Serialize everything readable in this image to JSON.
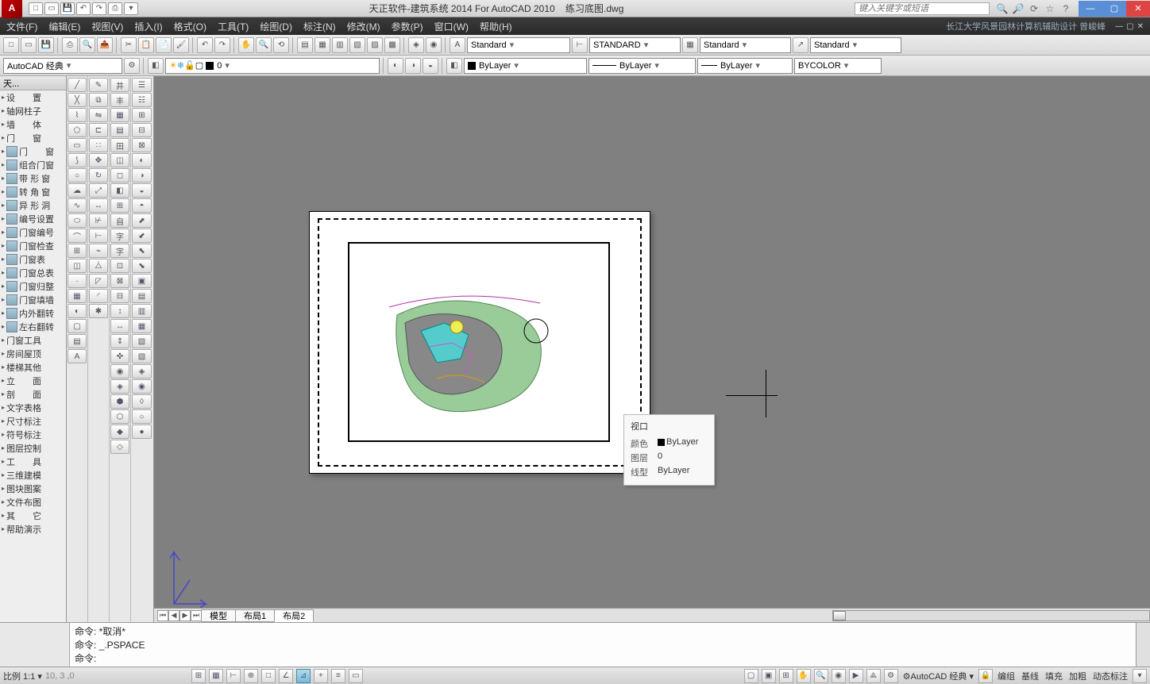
{
  "title": {
    "software": "天正软件-建筑系统 2014  For AutoCAD 2010",
    "file": "练习底图.dwg",
    "search_ph": "键入关键字或短语"
  },
  "menu": {
    "items": [
      "文件(F)",
      "编辑(E)",
      "视图(V)",
      "插入(I)",
      "格式(O)",
      "工具(T)",
      "绘图(D)",
      "标注(N)",
      "修改(M)",
      "参数(P)",
      "窗口(W)",
      "帮助(H)"
    ],
    "right": "长江大学风景园林计算机辅助设计 曾峻峰"
  },
  "tb1": {
    "style1": "Standard",
    "style2": "STANDARD",
    "style3": "Standard",
    "style4": "Standard"
  },
  "tb2": {
    "workspace": "AutoCAD 经典",
    "layer": "0",
    "bl1": "ByLayer",
    "bl2": "ByLayer",
    "bl3": "ByLayer",
    "bycolor": "BYCOLOR"
  },
  "lp": {
    "title": "天...",
    "items": [
      "设　　置",
      "轴网柱子",
      "墙　　体",
      "门　　窗",
      "门　　窗",
      "组合门窗",
      "带 形 窗",
      "转 角 窗",
      "异 形 洞",
      "编号设置",
      "门窗编号",
      "门窗检查",
      "门窗表",
      "门窗总表",
      "门窗归整",
      "门窗填墙",
      "内外翻转",
      "左右翻转",
      "门窗工具",
      "房间屋顶",
      "楼梯其他",
      "立　　面",
      "剖　　面",
      "文字表格",
      "尺寸标注",
      "符号标注",
      "图层控制",
      "工　　具",
      "三维建模",
      "图块图案",
      "文件布图",
      "其　　它",
      "帮助演示"
    ]
  },
  "tooltip": {
    "title": "视口",
    "r1l": "颜色",
    "r1v": "ByLayer",
    "r2l": "图层",
    "r2v": "0",
    "r3l": "线型",
    "r3v": "ByLayer"
  },
  "tabs": {
    "t1": "模型",
    "t2": "布局1",
    "t3": "布局2"
  },
  "cmd": {
    "l1": "命令: *取消*",
    "l2": "命令: _.PSPACE",
    "l3": "命令:"
  },
  "status": {
    "scale": "比例 1:1 ▾",
    "coord": "10,        3         ,0",
    "ws": "AutoCAD 经典 ▾",
    "b1": "编组",
    "b2": "基线",
    "b3": "填充",
    "b4": "加粗",
    "b5": "动态标注"
  }
}
